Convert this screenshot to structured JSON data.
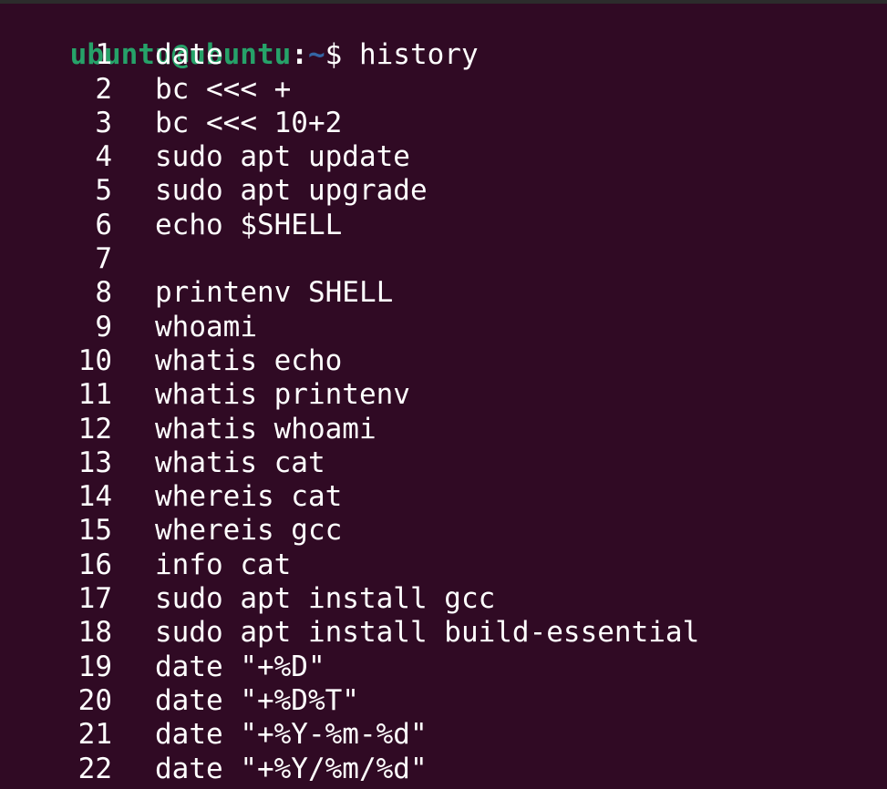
{
  "prompt": {
    "user_host": "ubuntu@ubuntu",
    "separator": ":",
    "path": "~",
    "dollar": "$ ",
    "command": "history"
  },
  "history": [
    {
      "num": "1",
      "cmd": "date"
    },
    {
      "num": "2",
      "cmd": "bc <<< +"
    },
    {
      "num": "3",
      "cmd": "bc <<< 10+2"
    },
    {
      "num": "4",
      "cmd": "sudo apt update"
    },
    {
      "num": "5",
      "cmd": "sudo apt upgrade"
    },
    {
      "num": "6",
      "cmd": "echo $SHELL"
    },
    {
      "num": "7",
      "cmd": ""
    },
    {
      "num": "8",
      "cmd": "printenv SHELL"
    },
    {
      "num": "9",
      "cmd": "whoami"
    },
    {
      "num": "10",
      "cmd": "whatis echo"
    },
    {
      "num": "11",
      "cmd": "whatis printenv"
    },
    {
      "num": "12",
      "cmd": "whatis whoami"
    },
    {
      "num": "13",
      "cmd": "whatis cat"
    },
    {
      "num": "14",
      "cmd": "whereis cat"
    },
    {
      "num": "15",
      "cmd": "whereis gcc"
    },
    {
      "num": "16",
      "cmd": "info cat"
    },
    {
      "num": "17",
      "cmd": "sudo apt install gcc"
    },
    {
      "num": "18",
      "cmd": "sudo apt install build-essential"
    },
    {
      "num": "19",
      "cmd": "date \"+%D\""
    },
    {
      "num": "20",
      "cmd": "date \"+%D%T\""
    },
    {
      "num": "21",
      "cmd": "date \"+%Y-%m-%d\""
    },
    {
      "num": "22",
      "cmd": "date \"+%Y/%m/%d\""
    }
  ]
}
